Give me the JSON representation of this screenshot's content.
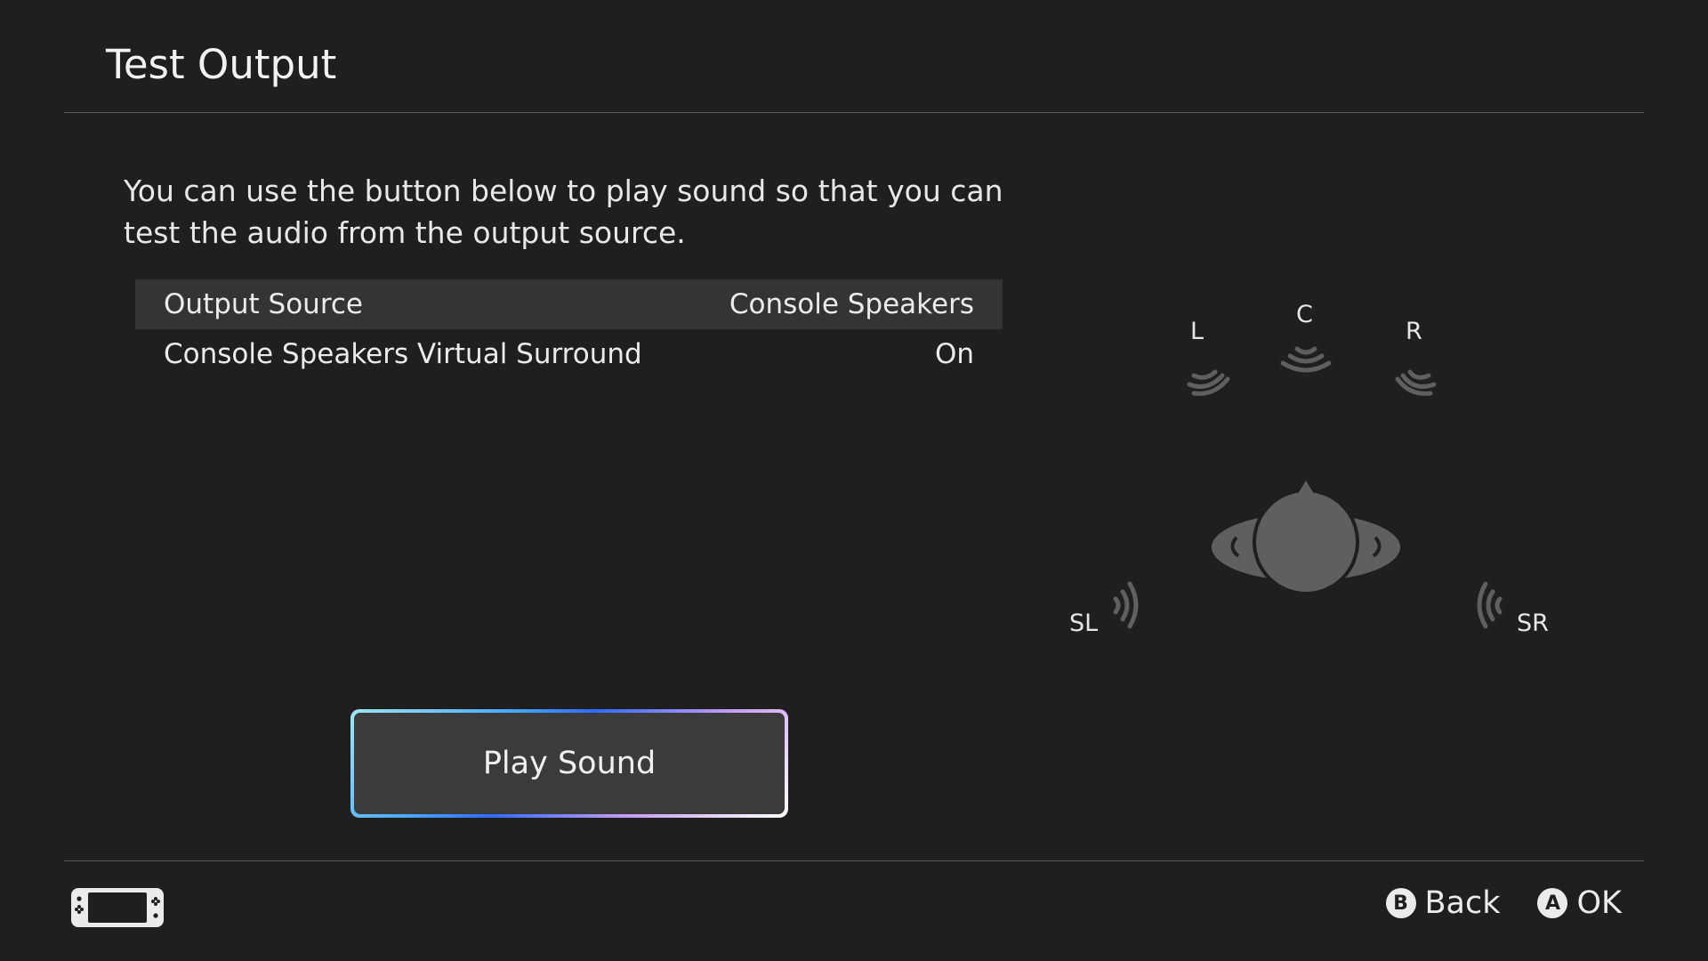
{
  "header": {
    "title": "Test Output"
  },
  "description": "You can use the button below to play sound so that you can test the audio from the output source.",
  "settings": [
    {
      "label": "Output Source",
      "value": "Console Speakers",
      "selected": true
    },
    {
      "label": "Console Speakers Virtual Surround",
      "value": "On",
      "selected": false
    }
  ],
  "play_button": {
    "label": "Play Sound"
  },
  "speaker_diagram": {
    "left": "L",
    "center": "C",
    "right": "R",
    "surround_left": "SL",
    "surround_right": "SR"
  },
  "footer": {
    "back_button_glyph": "B",
    "back_label": "Back",
    "ok_button_glyph": "A",
    "ok_label": "OK",
    "console_icon": "handheld-console-icon"
  },
  "colors": {
    "background": "#1f1f1f",
    "selected_row": "#343434",
    "button_fill": "#3b3b3b",
    "diagram_gray": "#5f5f5f"
  }
}
